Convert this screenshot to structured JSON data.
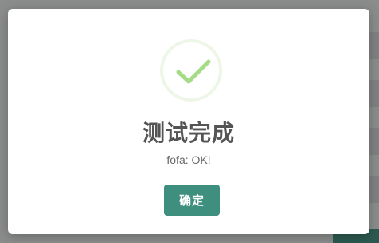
{
  "background": {
    "button_label": "确定"
  },
  "dialog": {
    "icon": "success-check-icon",
    "title": "测试完成",
    "message": "fofa: OK!",
    "confirm_label": "确定"
  },
  "colors": {
    "accent": "#3f8f7f",
    "check": "#a5dc86",
    "check_ring": "#eef6e8"
  }
}
